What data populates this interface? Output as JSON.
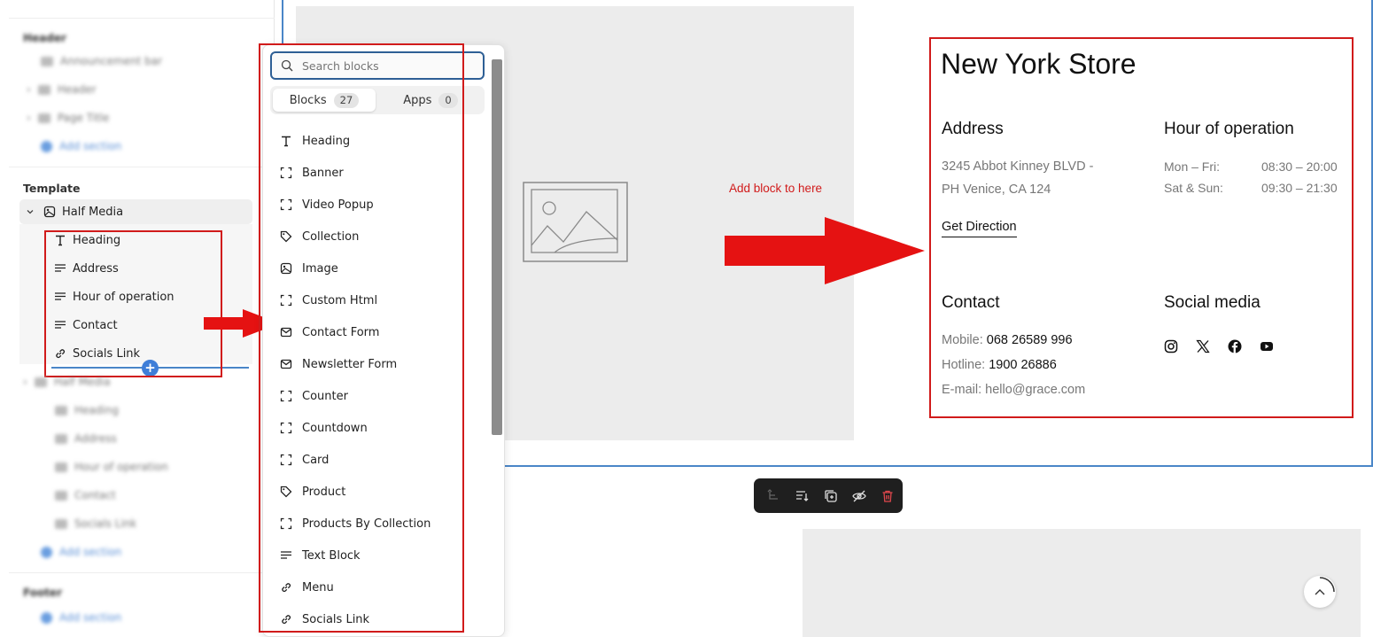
{
  "sidebar": {
    "header_group": "Header",
    "header_items": [
      "Announcement bar",
      "Header",
      "Page Title"
    ],
    "add_section": "Add section",
    "template_group": "Template",
    "section_name": "Half Media",
    "children": [
      {
        "label": "Heading",
        "icon": "text-icon"
      },
      {
        "label": "Address",
        "icon": "text-block-icon"
      },
      {
        "label": "Hour of operation",
        "icon": "text-block-icon"
      },
      {
        "label": "Contact",
        "icon": "text-block-icon"
      },
      {
        "label": "Socials Link",
        "icon": "link-icon"
      }
    ],
    "section2_name": "Half Media",
    "section2_children": [
      "Heading",
      "Address",
      "Hour of operation",
      "Contact",
      "Socials Link"
    ],
    "footer_group": "Footer"
  },
  "picker": {
    "search_placeholder": "Search blocks",
    "tabs": [
      {
        "label": "Blocks",
        "count": "27"
      },
      {
        "label": "Apps",
        "count": "0"
      }
    ],
    "blocks": [
      {
        "label": "Heading",
        "icon": "text-icon"
      },
      {
        "label": "Banner",
        "icon": "frame-icon"
      },
      {
        "label": "Video Popup",
        "icon": "frame-icon"
      },
      {
        "label": "Collection",
        "icon": "tag-icon"
      },
      {
        "label": "Image",
        "icon": "image-icon"
      },
      {
        "label": "Custom Html",
        "icon": "frame-icon"
      },
      {
        "label": "Contact Form",
        "icon": "mail-icon"
      },
      {
        "label": "Newsletter Form",
        "icon": "mail-icon"
      },
      {
        "label": "Counter",
        "icon": "frame-icon"
      },
      {
        "label": "Countdown",
        "icon": "frame-icon"
      },
      {
        "label": "Card",
        "icon": "frame-icon"
      },
      {
        "label": "Product",
        "icon": "tag-icon"
      },
      {
        "label": "Products By Collection",
        "icon": "frame-icon"
      },
      {
        "label": "Text Block",
        "icon": "text-block-icon"
      },
      {
        "label": "Menu",
        "icon": "link-icon"
      },
      {
        "label": "Socials Link",
        "icon": "link-icon"
      }
    ]
  },
  "preview": {
    "annotation": "Add block to here",
    "store_title": "New York Store",
    "address_heading": "Address",
    "address_line1": "3245 Abbot Kinney BLVD -",
    "address_line2": "PH Venice, CA 124",
    "direction_link": "Get Direction",
    "hours_heading": "Hour of operation",
    "hours": [
      {
        "day": "Mon – Fri:",
        "time": "08:30 – 20:00"
      },
      {
        "day": "Sat & Sun:",
        "time": "09:30 – 21:30"
      }
    ],
    "contact_heading": "Contact",
    "mobile_label": "Mobile:",
    "mobile_value": "068 26589 996",
    "hotline_label": "Hotline:",
    "hotline_value": "1900 26886",
    "email_label": "E-mail:",
    "email_value": "hello@grace.com",
    "social_heading": "Social media",
    "social_icons": [
      "instagram-icon",
      "x-icon",
      "facebook-icon",
      "youtube-icon"
    ]
  },
  "colors": {
    "annotation_red": "#d11b1b",
    "accent_blue": "#4a86c8",
    "toolbar_bg": "#1f1f1f",
    "delete_red": "#e0474c"
  }
}
